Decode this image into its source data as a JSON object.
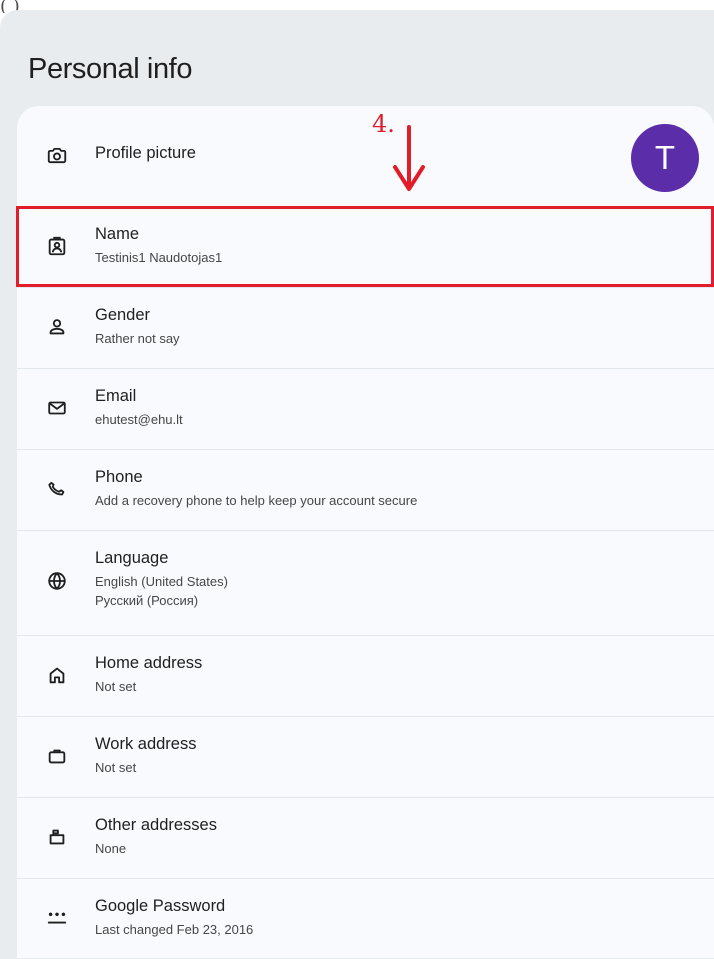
{
  "page": {
    "top_fragment": "(          )",
    "title": "Personal info"
  },
  "annotation": {
    "label": "4.",
    "highlighted_item": "Name",
    "color": "#e11d2a"
  },
  "personal_info": {
    "items": [
      {
        "title": "Profile picture",
        "avatar_initial": "T",
        "icon": "camera-icon",
        "avatar_color": "#5b2da8"
      },
      {
        "title": "Name",
        "subtitle": "Testinis1 Naudotojas1",
        "icon": "name-badge-icon"
      },
      {
        "title": "Gender",
        "subtitle": "Rather not say",
        "icon": "person-icon"
      },
      {
        "title": "Email",
        "subtitle": "ehutest@ehu.lt",
        "icon": "mail-icon"
      },
      {
        "title": "Phone",
        "subtitle": "Add a recovery phone to help keep your account secure",
        "icon": "phone-icon"
      },
      {
        "title": "Language",
        "subtitles": [
          "English (United States)",
          "Русский (Россия)"
        ],
        "icon": "globe-icon"
      },
      {
        "title": "Home address",
        "subtitle": "Not set",
        "icon": "home-icon"
      },
      {
        "title": "Work address",
        "subtitle": "Not set",
        "icon": "briefcase-icon"
      },
      {
        "title": "Other addresses",
        "subtitle": "None",
        "icon": "mailbox-icon"
      },
      {
        "title": "Google Password",
        "subtitle": "Last changed Feb 23, 2016",
        "icon": "password-icon"
      }
    ]
  }
}
